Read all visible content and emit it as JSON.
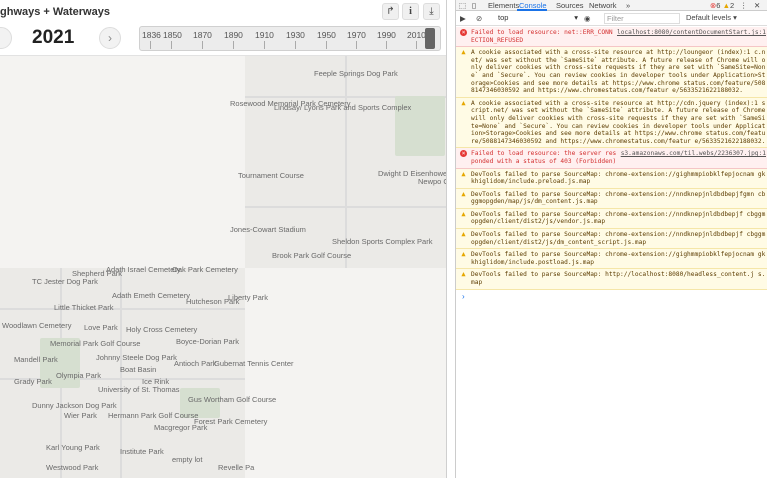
{
  "app": {
    "title": "ghways + Waterways",
    "share_icon": "share-icon",
    "info_icon": "info-icon",
    "download_icon": "download-icon",
    "share_glyph": "↱",
    "info_glyph": "i",
    "download_glyph": "⤓"
  },
  "yearbar": {
    "year": "2021",
    "next_glyph": "›",
    "ticks": [
      "1836",
      "1850",
      "1870",
      "1890",
      "1910",
      "1930",
      "1950",
      "1970",
      "1990",
      "2010"
    ]
  },
  "map": {
    "labels": [
      "Rosewood Memorial Park Cemetery",
      "Lindsay/ Lyons Park and Sports Complex",
      "Feeple Springs Dog Park",
      "Tournament Course",
      "Dwight D Eisenhower Park",
      "Newpo Golf Co",
      "Jones-Cowart Stadium",
      "Brook Park Golf Course",
      "Sheldon Sports Complex Park",
      "Shepherd Park",
      "Adath Israel Cemetery",
      "Oak Park Cemetery",
      "TC Jester Dog Park",
      "Little Thicket Park",
      "Adath Emeth Cemetery",
      "Hutcheson Park",
      "Liberty Park",
      "Woodlawn Cemetery",
      "Love Park",
      "Holy Cross Cemetery",
      "Memorial Park Golf Course",
      "Boyce-Dorian Park",
      "Johnny Steele Dog Park",
      "Antioch Park",
      "Gubernat Tennis Center",
      "Olympia Park",
      "Grady Park",
      "University of St. Thomas",
      "Ice Rink",
      "Gus Wortham Golf Course",
      "Dunny Jackson Dog Park",
      "Wier Park",
      "Hermann Park Golf Course",
      "Macgregor Park",
      "Forest Park Cemetery",
      "Karl Young Park",
      "Westwood Park",
      "Institute Park",
      "empty lot",
      "Revelle Pa",
      "Mandell Park",
      "Boat Basin"
    ]
  },
  "devtools": {
    "tabs": [
      "Elements",
      "Console",
      "Sources",
      "Network",
      "»"
    ],
    "error_count": "6",
    "warn_count": "2",
    "context": "top",
    "filter_placeholder": "Filter",
    "levels": "Default levels ▾",
    "messages": [
      {
        "type": "error",
        "text": "Failed to load resource: net::ERR_CONNECTION_REFUSED",
        "source": "localhost:8080/contentDocumentStart.js:1"
      },
      {
        "type": "warn",
        "text": "A cookie associated with a cross-site resource at http://loungeor (index):1 c.net/ was set without the `SameSite` attribute. A future release of Chrome will only deliver cookies with cross-site requests if they are set with `SameSite=None` and `Secure`. You can review cookies in developer tools under Application>Storage>Cookies and see more details at https://www.chrome status.com/feature/5088147346030592 and https://www.chromestatus.com/featur e/5633521622188032.",
        "source": ""
      },
      {
        "type": "warn",
        "text": "A cookie associated with a cross-site resource at http://cdn.jquery (index):1 script.net/ was set without the `SameSite` attribute. A future release of Chrome will only deliver cookies with cross-site requests if they are set with `SameSite=None` and `Secure`. You can review cookies in developer tools under Application>Storage>Cookies and see more details at https://www.chrome status.com/feature/5088147346030592 and https://www.chromestatus.com/featur e/5633521622188032.",
        "source": ""
      },
      {
        "type": "error",
        "text": "Failed to load resource: the server responded with a status of 403 (Forbidden)",
        "source": "s3.amazonaws.com/til.webs/2236307.jpg:1"
      },
      {
        "type": "warn",
        "text": "DevTools failed to parse SourceMap: chrome-extension://gighmmpiobklfepjocnam gkkhiglidom/include.preload.js.map",
        "source": ""
      },
      {
        "type": "warn",
        "text": "DevTools failed to parse SourceMap: chrome-extension://nndknepjnldbdbepjfgmn cbggmopgden/map/js/dm_content.js.map",
        "source": ""
      },
      {
        "type": "warn",
        "text": "DevTools failed to parse SourceMap: chrome-extension://nndknepjnldbdbepjf cbggmopgden/client/dist2/js/vendor.js.map",
        "source": ""
      },
      {
        "type": "warn",
        "text": "DevTools failed to parse SourceMap: chrome-extension://nndknepjnldbdbepjf cbggmopgden/client/dist2/js/dm_content_script.js.map",
        "source": ""
      },
      {
        "type": "warn",
        "text": "DevTools failed to parse SourceMap: chrome-extension://gighmmpiobklfepjocnam gkkhiglidom/include.postload.js.map",
        "source": ""
      },
      {
        "type": "warn",
        "text": "DevTools failed to parse SourceMap: http://localhost:8080/headless_content.j s.map",
        "source": ""
      }
    ],
    "prompt": "›"
  }
}
